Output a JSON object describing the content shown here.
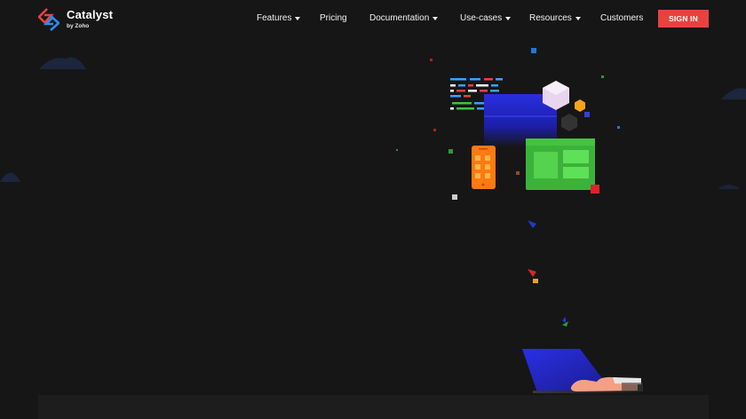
{
  "brand": {
    "name": "Catalyst",
    "sub": "by Zoho"
  },
  "nav": {
    "items": [
      {
        "label": "Features",
        "dropdown": true
      },
      {
        "label": "Pricing",
        "dropdown": false
      },
      {
        "label": "Documentation",
        "dropdown": true
      },
      {
        "label": "Use-cases",
        "dropdown": true
      },
      {
        "label": "Resources",
        "dropdown": true
      },
      {
        "label": "Customers",
        "dropdown": false
      }
    ],
    "signin_label": "SIGN IN"
  },
  "colors": {
    "background": "#161616",
    "accent": "#e8423f",
    "logo_red": "#e8423f",
    "logo_blue": "#2b8df0"
  },
  "icons": {
    "logo": "catalyst-logo-icon",
    "caret": "caret-down-icon"
  }
}
